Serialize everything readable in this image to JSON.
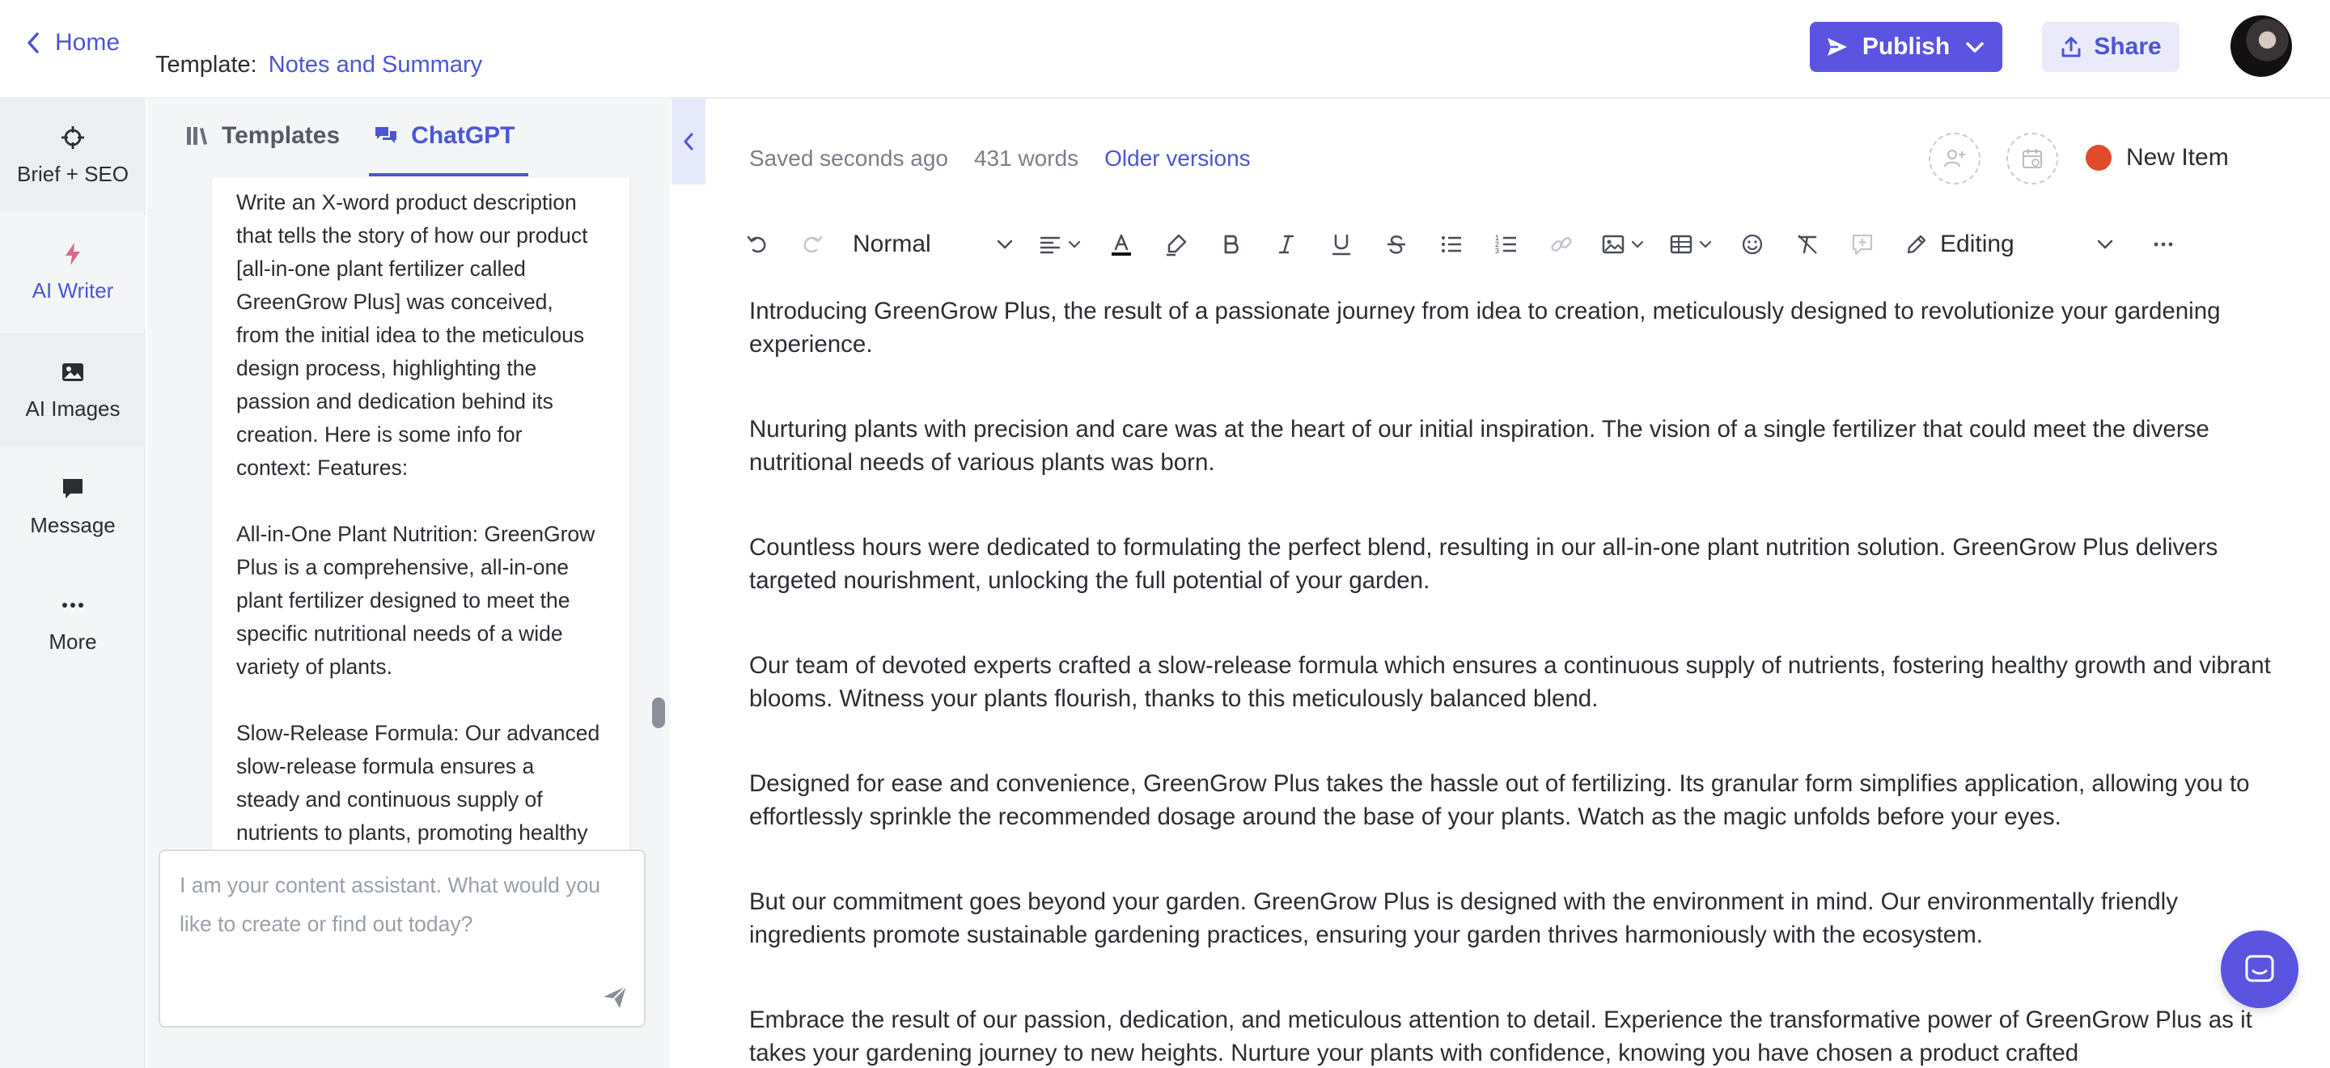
{
  "header": {
    "home_label": "Home",
    "template_prefix": "Template:",
    "template_name": "Notes and Summary",
    "publish_label": "Publish",
    "share_label": "Share"
  },
  "rail": {
    "items": [
      {
        "label": "Brief + SEO",
        "icon": "target-icon"
      },
      {
        "label": "AI Writer",
        "icon": "lightning-icon"
      },
      {
        "label": "AI Images",
        "icon": "image-icon"
      },
      {
        "label": "Message",
        "icon": "message-icon"
      },
      {
        "label": "More",
        "icon": "more-icon"
      }
    ]
  },
  "panel": {
    "tabs": [
      {
        "label": "Templates"
      },
      {
        "label": "ChatGPT"
      }
    ],
    "chat_paragraphs": [
      "Write an X-word product description that tells the story of how our product [all-in-one plant fertilizer called GreenGrow Plus] was conceived, from the initial idea to the meticulous design process, highlighting the passion and dedication behind its creation. Here is some info for context: Features:",
      "All-in-One Plant Nutrition: GreenGrow Plus is a comprehensive, all-in-one plant fertilizer designed to meet the specific nutritional needs of a wide variety of plants.",
      "Slow-Release Formula: Our advanced slow-release formula ensures a steady and continuous supply of nutrients to plants, promoting healthy growth and vibrant blooms."
    ],
    "input_placeholder": "I am your content assistant. What would you like to create or find out today?"
  },
  "editor": {
    "saved_status": "Saved seconds ago",
    "word_count": "431 words",
    "older_versions": "Older versions",
    "new_item_label": "New Item",
    "new_item_color": "#e04a2a",
    "style_value": "Normal",
    "mode_value": "Editing",
    "paragraphs": [
      "Introducing GreenGrow Plus, the result of a passionate journey from idea to creation, meticulously designed to revolutionize your gardening experience.",
      "Nurturing plants with precision and care was at the heart of our initial inspiration. The vision of a single fertilizer that could meet the diverse nutritional needs of various plants was born.",
      "Countless hours were dedicated to formulating the perfect blend, resulting in our all-in-one plant nutrition solution. GreenGrow Plus delivers targeted nourishment, unlocking the full potential of your garden.",
      "Our team of devoted experts crafted a slow-release formula which ensures a continuous supply of nutrients, fostering healthy growth and vibrant blooms. Witness your plants flourish, thanks to this meticulously balanced blend.",
      "Designed for ease and convenience, GreenGrow Plus takes the hassle out of fertilizing. Its granular form simplifies application, allowing you to effortlessly sprinkle the recommended dosage around the base of your plants. Watch as the magic unfolds before your eyes.",
      "But our commitment goes beyond your garden. GreenGrow Plus is designed with the environment in mind. Our environmentally friendly ingredients promote sustainable gardening practices, ensuring your garden thrives harmoniously with the ecosystem.",
      "Embrace the result of our passion, dedication, and meticulous attention to detail. Experience the transformative power of GreenGrow Plus as it takes your gardening journey to new heights. Nurture your plants with confidence, knowing you have chosen a product crafted"
    ]
  },
  "colors": {
    "accent": "#5a54e0",
    "link": "#4b55d6"
  }
}
